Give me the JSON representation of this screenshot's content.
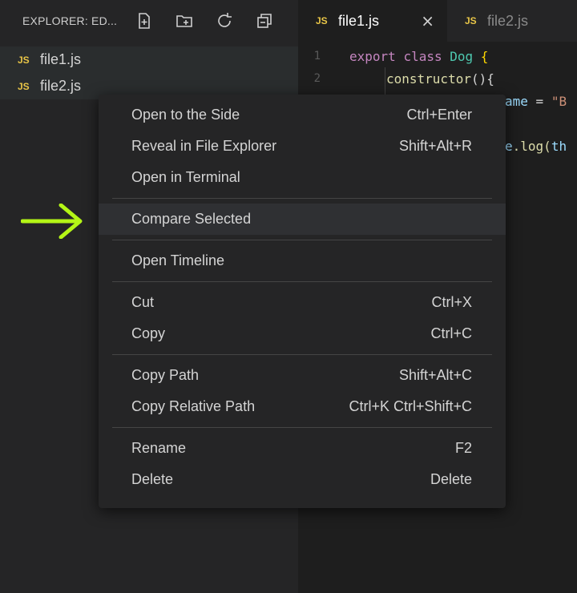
{
  "sidebar": {
    "title": "EXPLORER: ED...",
    "actions": [
      {
        "icon": "new-file-icon"
      },
      {
        "icon": "new-folder-icon"
      },
      {
        "icon": "refresh-icon"
      },
      {
        "icon": "collapse-all-icon"
      }
    ],
    "files": [
      {
        "badge": "JS",
        "name": "file1.js"
      },
      {
        "badge": "JS",
        "name": "file2.js"
      }
    ]
  },
  "editor": {
    "tabs": [
      {
        "badge": "JS",
        "label": "file1.js",
        "close": "×"
      },
      {
        "badge": "JS",
        "label": "file2.js"
      }
    ],
    "lines": [
      {
        "no": "1",
        "tokens": [
          "export",
          "class",
          "Dog",
          "{"
        ]
      },
      {
        "no": "2",
        "tokens": [
          "constructor",
          "(){"
        ]
      },
      {
        "tokens": [
          "ame",
          "=",
          "\"B"
        ]
      },
      {
        "tokens": [
          "e",
          ".log(",
          "th"
        ]
      }
    ]
  },
  "context_menu": {
    "items": [
      {
        "label": "Open to the Side",
        "shortcut": "Ctrl+Enter"
      },
      {
        "label": "Reveal in File Explorer",
        "shortcut": "Shift+Alt+R"
      },
      {
        "label": "Open in Terminal",
        "shortcut": ""
      },
      {
        "label": "Compare Selected",
        "shortcut": ""
      },
      {
        "label": "Open Timeline",
        "shortcut": ""
      },
      {
        "label": "Cut",
        "shortcut": "Ctrl+X"
      },
      {
        "label": "Copy",
        "shortcut": "Ctrl+C"
      },
      {
        "label": "Copy Path",
        "shortcut": "Shift+Alt+C"
      },
      {
        "label": "Copy Relative Path",
        "shortcut": "Ctrl+K Ctrl+Shift+C"
      },
      {
        "label": "Rename",
        "shortcut": "F2"
      },
      {
        "label": "Delete",
        "shortcut": "Delete"
      }
    ]
  },
  "colors": {
    "js_badge": "#e8c547",
    "arrow": "#b4f516",
    "keyword": "#c586c0",
    "class_name": "#4ec9b0"
  }
}
